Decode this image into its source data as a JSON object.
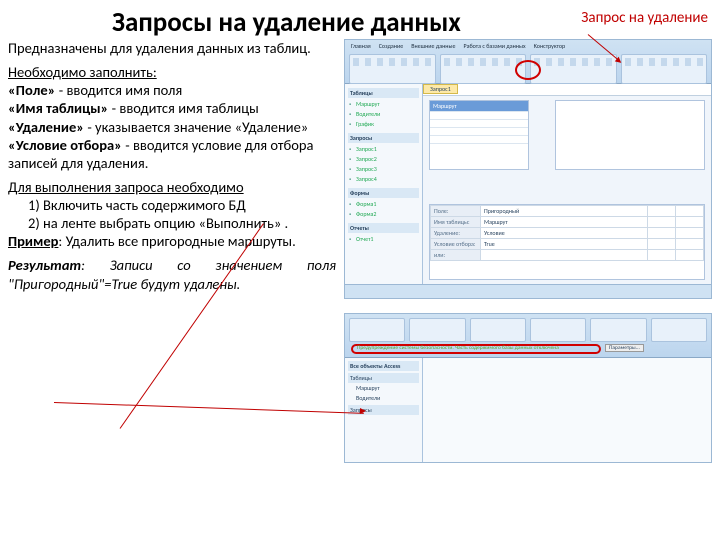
{
  "header": {
    "title": "Запросы на удаление данных",
    "corner": "Запрос на удаление"
  },
  "text": {
    "intro": "Предназначены для удаления данных из таблиц.",
    "fill_hdr": "Необходимо заполнить:",
    "field_lbl": "«Поле»",
    "field_txt": " - вводится имя поля",
    "table_lbl": "«Имя таблицы»",
    "table_txt": " - вводится имя таблицы",
    "del_lbl": "«Удаление»",
    "del_txt": " - указывается значение «Удаление»",
    "cond_lbl": "«Условие отбора»",
    "cond_txt": " - вводится условие для отбора записей для удаления.",
    "exec_hdr": "Для выполнения запроса необходимо",
    "step1": "1)   Включить часть содержимого БД",
    "step2": "2)   на ленте выбрать опцию «Выполнить» .",
    "example_lbl": "Пример",
    "example_txt": ": Удалить все пригородные маршруты.",
    "result_lbl": "Результат",
    "result_txt": ": Записи со значением поля \"Пригородный\"=True будут удалены."
  },
  "shot1": {
    "ribbon_tabs": [
      "Главная",
      "Создание",
      "Внешние данные",
      "Работа с базами данных",
      "Конструктор"
    ],
    "nav": {
      "g1": "Таблицы",
      "g1items": [
        "Маршрут",
        "Водители",
        "График"
      ],
      "g2": "Запросы",
      "g2items": [
        "Запрос1",
        "Запрос2",
        "Запрос3",
        "Запрос4"
      ],
      "g3": "Формы",
      "g3items": [
        "Форма1",
        "Форма2"
      ],
      "g4": "Отчеты",
      "g4items": [
        "Отчет1"
      ]
    },
    "tab": "Запрос1",
    "box_hd": "Маршрут",
    "grid": {
      "r1": "Поле:",
      "r2": "Имя таблицы:",
      "r3": "Удаление:",
      "r4": "Условие отбора:",
      "r5": "или:",
      "c1": "Пригородный",
      "c2": "Маршрут",
      "c3": "Условие",
      "c4": "True"
    }
  },
  "shot2": {
    "warn": "Предупреждение системы безопасности. Часть содержимого базы данных отключена",
    "btn": "Параметры...",
    "nav_h": "Все объекты Access",
    "g1": "Таблицы",
    "i1": "Маршрут",
    "i2": "Водители",
    "g2": "Запросы"
  }
}
